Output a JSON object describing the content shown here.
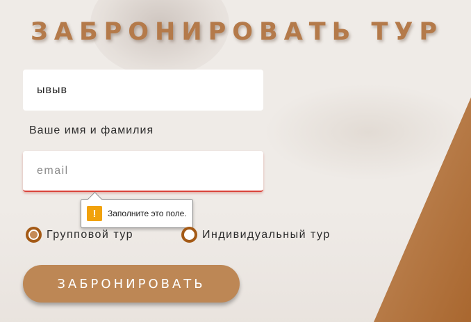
{
  "form": {
    "title": "ЗАБРОНИРОВАТЬ ТУР",
    "name_value": "ывыв",
    "name_hint": "Ваше имя и фамилия",
    "email_placeholder": "email",
    "validation_tooltip": "Заполните это поле.",
    "validation_icon": "warning-icon",
    "radio_options": [
      {
        "label": "Групповой тур",
        "selected": true
      },
      {
        "label": "Индивидуальный тур",
        "selected": false
      }
    ],
    "submit_label": "ЗАБРОНИРОВАТЬ"
  },
  "colors": {
    "accent": "#bd8755",
    "title": "#b47a4a",
    "radio_border": "#a45a16",
    "warning": "#f1a20c",
    "error_underline": "#d9433a"
  }
}
